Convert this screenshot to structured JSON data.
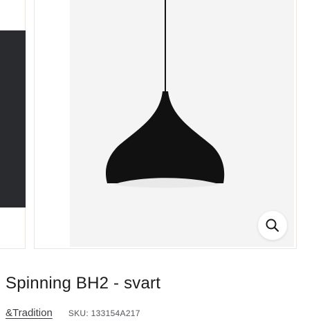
{
  "product": {
    "title": "Spinning BH2 - svart",
    "brand": "&Tradition",
    "sku_label": "SKU:",
    "sku_value": "133154A217"
  },
  "gallery": {
    "main_image": "pendant-lamp-black",
    "zoom_icon": "magnifier-icon"
  },
  "colors": {
    "lamp": "#111111",
    "background": "#f4f4f5",
    "thumbnail_dark": "#2a2b2f",
    "frame_border": "#ebe7df"
  }
}
